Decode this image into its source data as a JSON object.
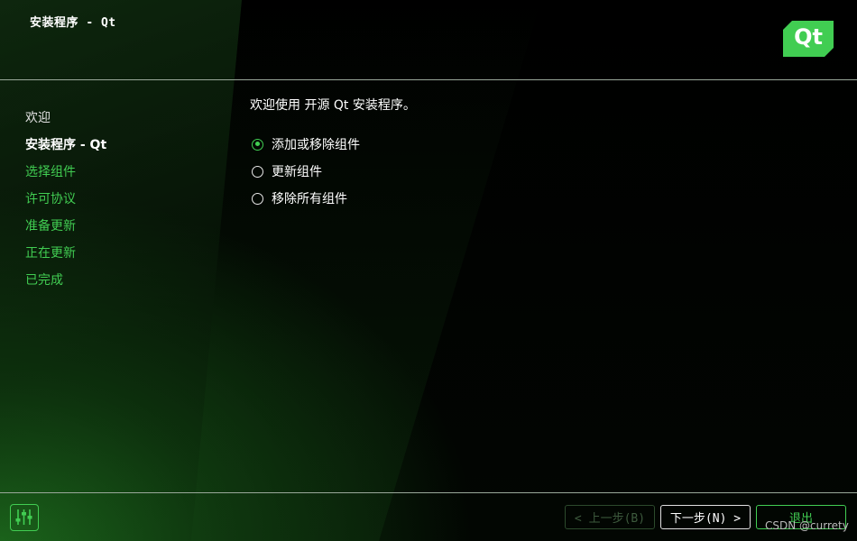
{
  "window": {
    "title": "安装程序 - Qt"
  },
  "logo": {
    "text": "Qt",
    "color": "#41cd52"
  },
  "sidebar": {
    "items": [
      {
        "label": "欢迎"
      },
      {
        "label": "安装程序 - Qt"
      },
      {
        "label": "选择组件"
      },
      {
        "label": "许可协议"
      },
      {
        "label": "准备更新"
      },
      {
        "label": "正在更新"
      },
      {
        "label": "已完成"
      }
    ]
  },
  "main": {
    "welcome_text": "欢迎使用 开源 Qt 安装程序。",
    "options": [
      {
        "label": "添加或移除组件",
        "selected": true
      },
      {
        "label": "更新组件",
        "selected": false
      },
      {
        "label": "移除所有组件",
        "selected": false
      }
    ]
  },
  "footer": {
    "settings_icon": "sliders-icon",
    "back_label": "< 上一步(B)",
    "next_label": "下一步(N) >",
    "quit_label": "退出"
  },
  "watermark": "CSDN @currety",
  "colors": {
    "accent": "#41cd52",
    "background": "#000000"
  }
}
